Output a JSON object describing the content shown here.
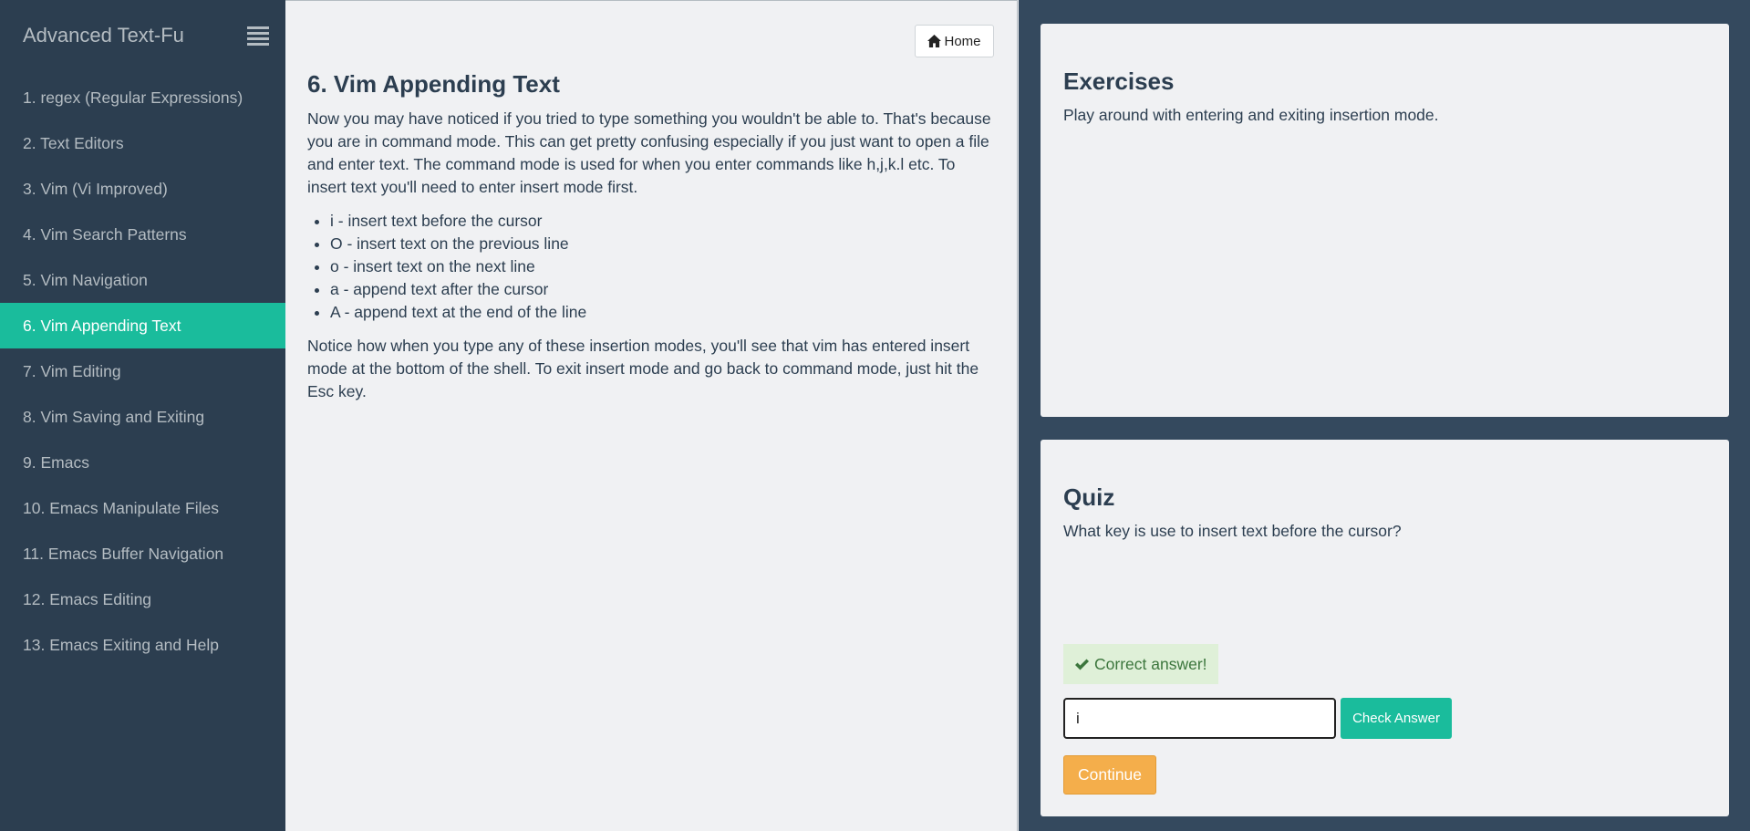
{
  "sidebar": {
    "title": "Advanced Text-Fu",
    "menu_icon": "hamburger-menu-icon",
    "items": [
      {
        "label": "1. regex (Regular Expressions)",
        "active": false
      },
      {
        "label": "2. Text Editors",
        "active": false
      },
      {
        "label": "3. Vim (Vi Improved)",
        "active": false
      },
      {
        "label": "4. Vim Search Patterns",
        "active": false
      },
      {
        "label": "5. Vim Navigation",
        "active": false
      },
      {
        "label": "6. Vim Appending Text",
        "active": true
      },
      {
        "label": "7. Vim Editing",
        "active": false
      },
      {
        "label": "8. Vim Saving and Exiting",
        "active": false
      },
      {
        "label": "9. Emacs",
        "active": false
      },
      {
        "label": "10. Emacs Manipulate Files",
        "active": false
      },
      {
        "label": "11. Emacs Buffer Navigation",
        "active": false
      },
      {
        "label": "12. Emacs Editing",
        "active": false
      },
      {
        "label": "13. Emacs Exiting and Help",
        "active": false
      }
    ]
  },
  "main": {
    "home_button": {
      "label": "Home",
      "icon": "home-icon"
    },
    "title": "6. Vim Appending Text",
    "intro": "Now you may have noticed if you tried to type something you wouldn't be able to. That's because you are in command mode. This can get pretty confusing especially if you just want to open a file and enter text. The command mode is used for when you enter commands like h,j,k.l etc. To insert text you'll need to enter insert mode first.",
    "list": [
      "i - insert text before the cursor",
      "O - insert text on the previous line",
      "o - insert text on the next line",
      "a - append text after the cursor",
      "A - append text at the end of the line"
    ],
    "outro": "Notice how when you type any of these insertion modes, you'll see that vim has entered insert mode at the bottom of the shell. To exit insert mode and go back to command mode, just hit the Esc key."
  },
  "exercises": {
    "title": "Exercises",
    "text": "Play around with entering and exiting insertion mode."
  },
  "quiz": {
    "title": "Quiz",
    "question": "What key is use to insert text before the cursor?",
    "feedback": "Correct answer!",
    "feedback_icon": "checkmark-icon",
    "answer_value": "i",
    "check_label": "Check Answer",
    "continue_label": "Continue"
  },
  "colors": {
    "sidebar_bg": "#2c3e50",
    "active_item": "#1abc9c",
    "right_bg": "#34495e",
    "continue": "#f4ae4b",
    "success_bg": "#dff0d8",
    "success_text": "#3c763d"
  }
}
